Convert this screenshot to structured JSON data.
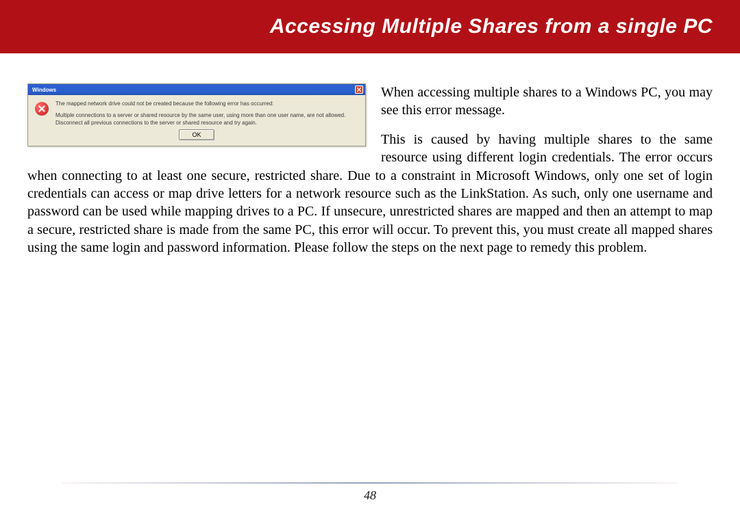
{
  "header": {
    "title": "Accessing Multiple Shares from a single PC"
  },
  "dialog": {
    "titlebar": "Windows",
    "line1": "The mapped network drive could not be created because the following error has occurred:",
    "line2": "Multiple connections to a server or shared resource by the same user, using more than one user name, are not allowed. Disconnect all previous connections to the server or shared resource and try again.",
    "ok": "OK"
  },
  "body": {
    "lead": "When accessing multiple shares to a Windows PC, you may see this error message.",
    "main": "This is caused by having multiple shares to the same resource using different login credentials.  The error occurs when connecting to at least one secure, restricted share.  Due to a constraint in Microsoft Windows, only one set of login credentials can access or map drive letters for a network resource such as the LinkStation.  As such, only one username and password can be used while mapping drives to a PC.  If unsecure, unrestricted shares are mapped and then an attempt to map a secure, restricted share is made from the same PC, this error will occur.  To prevent this, you must create all mapped shares using the same login and password information.  Please follow the steps on the next page to remedy this problem."
  },
  "page_number": "48"
}
